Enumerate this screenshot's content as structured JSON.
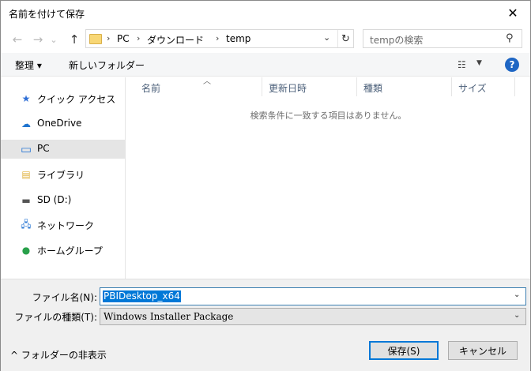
{
  "window": {
    "title": "名前を付けて保存",
    "close_glyph": "✕"
  },
  "nav": {
    "back_glyph": "←",
    "forward_glyph": "→",
    "recent_glyph": "⌄",
    "up_glyph": "↑"
  },
  "address": {
    "crumbs": [
      "PC",
      "ダウンロード",
      "temp"
    ],
    "separator": "›",
    "dropdown_glyph": "⌄",
    "refresh_glyph": "↻"
  },
  "search": {
    "placeholder": "tempの検索",
    "icon_glyph": "⚲"
  },
  "toolbar": {
    "organize_label": "整理 ▾",
    "new_folder_label": "新しいフォルダー",
    "view_glyph": "☷",
    "view_dd_glyph": "▼",
    "help_glyph": "?"
  },
  "sidebar": {
    "items": [
      {
        "label": "クイック アクセス",
        "icon": "star-icon",
        "glyph": "★",
        "color": "#2f6fd6"
      },
      {
        "label": "OneDrive",
        "icon": "cloud-icon",
        "glyph": "☁",
        "color": "#1f74cf"
      },
      {
        "label": "PC",
        "icon": "computer-icon",
        "glyph": "▭",
        "color": "#2b78d4"
      },
      {
        "label": "ライブラリ",
        "icon": "library-icon",
        "glyph": "▤",
        "color": "#e0b23e"
      },
      {
        "label": "SD (D:)",
        "icon": "drive-icon",
        "glyph": "▬",
        "color": "#555555"
      },
      {
        "label": "ネットワーク",
        "icon": "network-icon",
        "glyph": "🖧",
        "color": "#2b78d4"
      },
      {
        "label": "ホームグループ",
        "icon": "homegroup-icon",
        "glyph": "●",
        "color": "#28a04a"
      }
    ]
  },
  "filelist": {
    "columns": [
      "名前",
      "更新日時",
      "種類",
      "サイズ"
    ],
    "sort_glyph": "︿",
    "empty_message": "検索条件に一致する項目はありません。"
  },
  "form": {
    "filename_label": "ファイル名(N):",
    "filename_value": "PBIDesktop_x64",
    "filetype_label": "ファイルの種類(T):",
    "filetype_value": "Windows Installer Package",
    "dropdown_glyph": "⌄"
  },
  "footer": {
    "hide_folders_label": "^  フォルダーの非表示",
    "save_label": "保存(S)",
    "cancel_label": "キャンセル"
  },
  "colors": {
    "accent": "#0078d7",
    "selection_bg": "#e5e5e5"
  }
}
